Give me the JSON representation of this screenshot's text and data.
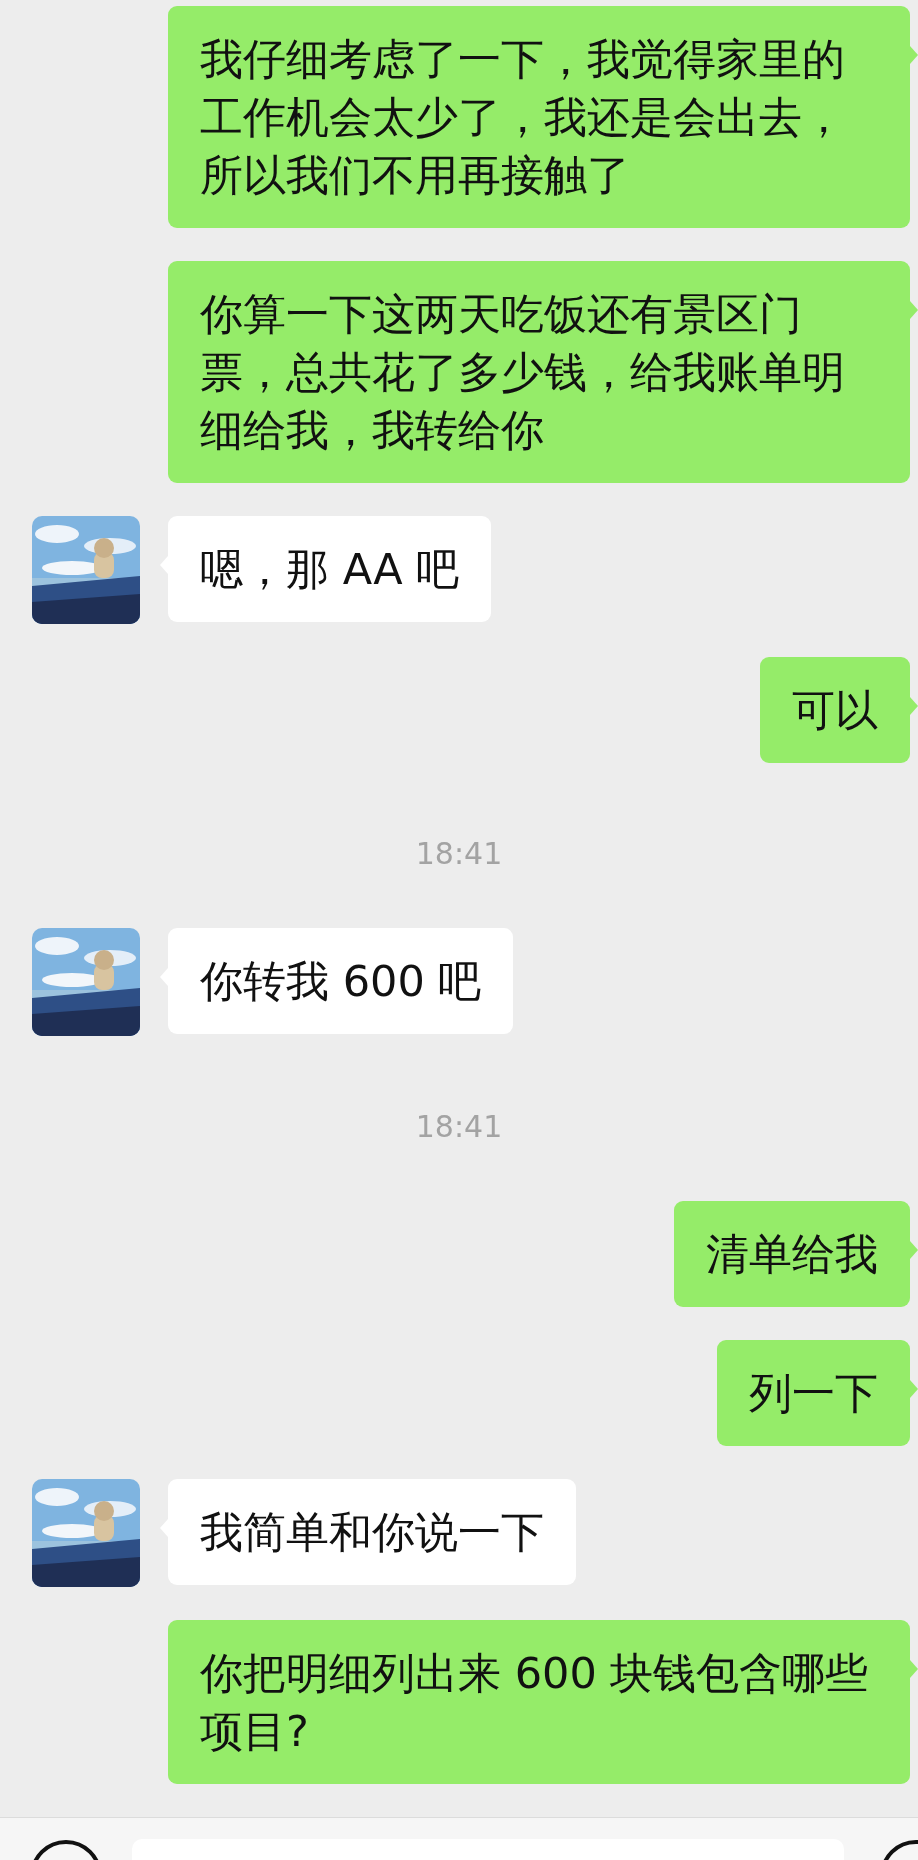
{
  "messages": [
    {
      "kind": "sent",
      "text": "我仔细考虑了一下，我觉得家里的工作机会太少了，我还是会出去，所以我们不用再接触了"
    },
    {
      "kind": "sent",
      "text": "你算一下这两天吃饭还有景区门票，总共花了多少钱，给我账单明细给我，我转给你"
    },
    {
      "kind": "received",
      "text": "嗯，那 AA 吧"
    },
    {
      "kind": "sent",
      "text": "可以"
    },
    {
      "kind": "time",
      "text": "18:41"
    },
    {
      "kind": "received",
      "text": "你转我 600 吧"
    },
    {
      "kind": "time",
      "text": "18:41"
    },
    {
      "kind": "sent",
      "text": "清单给我"
    },
    {
      "kind": "sent",
      "text": "列一下"
    },
    {
      "kind": "received",
      "text": "我简单和你说一下"
    },
    {
      "kind": "sent",
      "text": "你把明细列出来 600 块钱包含哪些项目?"
    }
  ]
}
